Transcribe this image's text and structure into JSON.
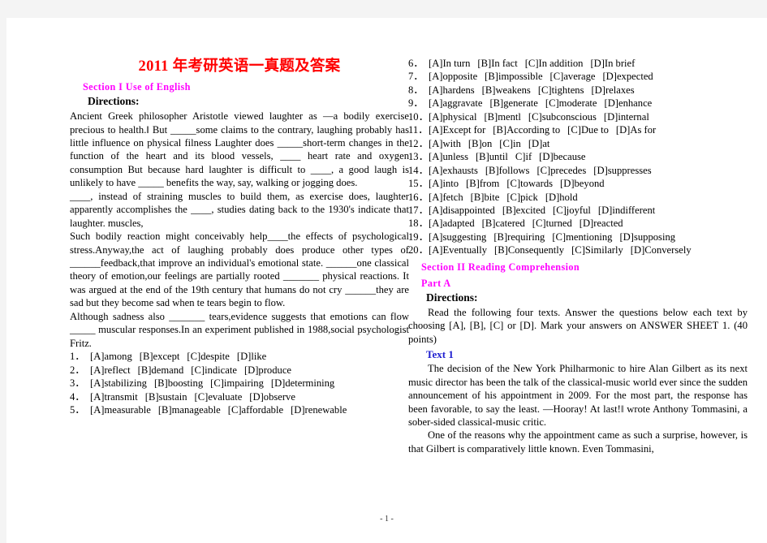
{
  "document": {
    "title": "2011 年考研英语一真题及答案",
    "footer": "- 1 -"
  },
  "left_column": {
    "section_heading": "Section I Use of English",
    "directions_label": "Directions:",
    "paragraphs": [
      "Ancient Greek philosopher Aristotle viewed laughter as —a bodily exercise precious to health.‖ But _____some claims to the contrary, laughing probably has little influence on physical filness Laughter does _____short-term changes in the function of the heart and its blood vessels, ____ heart rate and oxygen consumption But because hard laughter is difficult to ____, a good laugh is unlikely to have _____ benefits the way, say, walking or jogging does.",
      "____, instead of straining muscles to build them, as exercise does, laughter apparently accomplishes the ____, studies dating back to the 1930's indicate that laughter. muscles,",
      "Such bodily reaction might conceivably help____the effects of psychological stress.Anyway,the act of laughing probably does produce other types of ______feedback,that improve an individual's emotional state. ______one classical theory of emotion,our feelings are partially rooted _______ physical reactions. It was argued at the end of the 19th century that humans do not cry ______they are sad but they become sad when te tears begin to flow.",
      "Although sadness also _______ tears,evidence suggests that emotions can flow _____ muscular responses.In an experiment published in 1988,social psychologist Fritz."
    ],
    "questions": [
      {
        "num": "1．",
        "options": [
          "[A]among",
          "[B]except",
          "[C]despite",
          "[D]like"
        ]
      },
      {
        "num": "2．",
        "options": [
          "[A]reflect",
          "[B]demand",
          "[C]indicate",
          "[D]produce"
        ]
      },
      {
        "num": "3．",
        "options": [
          "[A]stabilizing",
          "[B]boosting",
          "[C]impairing",
          "[D]determining"
        ]
      },
      {
        "num": "4．",
        "options": [
          "[A]transmit",
          "[B]sustain",
          "[C]evaluate",
          "[D]observe"
        ]
      },
      {
        "num": "5．",
        "options": [
          "[A]measurable",
          "[B]manageable",
          "[C]affordable",
          "[D]renewable"
        ]
      }
    ]
  },
  "right_column": {
    "questions": [
      {
        "num": "6．",
        "options": [
          "[A]In turn",
          "[B]In fact",
          "[C]In addition",
          "[D]In brief"
        ]
      },
      {
        "num": "7．",
        "options": [
          "[A]opposite",
          "[B]impossible",
          "[C]average",
          "[D]expected"
        ]
      },
      {
        "num": "8．",
        "options": [
          "[A]hardens",
          "[B]weakens",
          "[C]tightens",
          "[D]relaxes"
        ]
      },
      {
        "num": "9．",
        "options": [
          "[A]aggravate",
          "[B]generate",
          "[C]moderate",
          "[D]enhance"
        ]
      },
      {
        "num": "10．",
        "options": [
          "[A]physical",
          "[B]mentl",
          "[C]subconscious",
          "[D]internal"
        ]
      },
      {
        "num": "11．",
        "options": [
          "[A]Except for",
          "[B]According to",
          "[C]Due to",
          "[D]As for"
        ]
      },
      {
        "num": "12．",
        "options": [
          "[A]with",
          "[B]on",
          "[C]in",
          "[D]at"
        ]
      },
      {
        "num": "13．",
        "options": [
          "[A]unless",
          "[B]until",
          "C]if",
          "[D]because"
        ]
      },
      {
        "num": "14．",
        "options": [
          "[A]exhausts",
          "[B]follows",
          "[C]precedes",
          "[D]suppresses"
        ]
      },
      {
        "num": "15．",
        "options": [
          "[A]into",
          "[B]from",
          "[C]towards",
          "[D]beyond"
        ]
      },
      {
        "num": "16．",
        "options": [
          "[A]fetch",
          "[B]bite",
          "[C]pick",
          "[D]hold"
        ]
      },
      {
        "num": "17．",
        "options": [
          "[A]disappointed",
          "[B]excited",
          "[C]joyful",
          "[D]indifferent"
        ]
      },
      {
        "num": "18．",
        "options": [
          "[A]adapted",
          "[B]catered",
          "[C]turned",
          "[D]reacted"
        ]
      },
      {
        "num": "19．",
        "options": [
          "[A]suggesting",
          "[B]requiring",
          "[C]mentioning",
          "[D]supposing"
        ]
      },
      {
        "num": "20．",
        "options": [
          "[A]Eventually",
          "[B]Consequently",
          "[C]Similarly",
          "[D]Conversely"
        ]
      }
    ],
    "section_heading": "Section II Reading Comprehension",
    "part_heading": "Part A",
    "directions_label": "Directions:",
    "directions_body": "Read the following four texts. Answer the questions below each text by choosing [A], [B], [C] or [D]. Mark your answers on ANSWER SHEET 1. (40 points)",
    "text_heading": "Text 1",
    "text_paragraphs": [
      "The decision of the New York Philharmonic to hire Alan Gilbert as its next music director has been the talk of the classical-music world ever since the sudden announcement of his appointment in 2009. For the most part, the response has been favorable, to say the least. —Hooray! At last!‖ wrote Anthony Tommasini, a sober-sided classical-music critic.",
      "One of the reasons why the appointment came as such a surprise, however, is that Gilbert is comparatively little known. Even Tommasini,"
    ]
  },
  "colors": {
    "title_red": "#ff0000",
    "section_magenta": "#ff00ff",
    "text_blue": "#1f1fd0",
    "body_black": "#000000",
    "page_bg": "#ffffff",
    "canvas_bg": "#f4f4f4"
  }
}
